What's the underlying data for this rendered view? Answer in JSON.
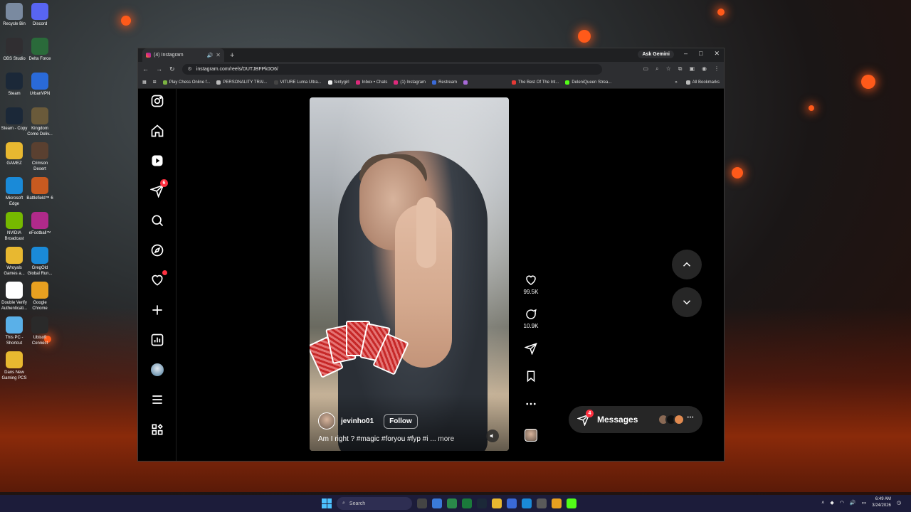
{
  "desktop": {
    "icons": [
      {
        "label": "Recycle Bin",
        "icon": "recycle-bin-icon",
        "color": "#7a8aa0"
      },
      {
        "label": "Discord",
        "icon": "discord-icon",
        "color": "#5865f2"
      },
      {
        "label": "OBS Studio",
        "icon": "obs-icon",
        "color": "#302e31"
      },
      {
        "label": "Delta Force",
        "icon": "delta-force-icon",
        "color": "#2a6a3a"
      },
      {
        "label": "Steam",
        "icon": "steam-icon",
        "color": "#1b2838"
      },
      {
        "label": "UrbanVPN",
        "icon": "urbanvpn-icon",
        "color": "#2a6ad8"
      },
      {
        "label": "Steam - Copy",
        "icon": "steam-icon",
        "color": "#1b2838"
      },
      {
        "label": "Kingdom Come Deliv...",
        "icon": "kingdom-come-icon",
        "color": "#6a5a3a"
      },
      {
        "label": "GAMEZ",
        "icon": "folder-icon",
        "color": "#e8b830"
      },
      {
        "label": "Crimson Desert",
        "icon": "crimson-desert-icon",
        "color": "#5a4030"
      },
      {
        "label": "Microsoft Edge",
        "icon": "edge-icon",
        "color": "#1a8ad8"
      },
      {
        "label": "Battlefield™ 6",
        "icon": "battlefield-icon",
        "color": "#c85a20"
      },
      {
        "label": "NVIDIA Broadcast",
        "icon": "nvidia-icon",
        "color": "#76b900"
      },
      {
        "label": "eFootball™",
        "icon": "efootball-icon",
        "color": "#b02a8a"
      },
      {
        "label": "Wroyals Games a...",
        "icon": "folder-icon",
        "color": "#e8b830"
      },
      {
        "label": "GregOld Global Run...",
        "icon": "edge-icon",
        "color": "#1a8ad8"
      },
      {
        "label": "Double Verify Authenticati...",
        "icon": "document-icon",
        "color": "#ffffff"
      },
      {
        "label": "Google Chrome",
        "icon": "chrome-icon",
        "color": "#e8a020"
      },
      {
        "label": "This PC - Shortcut",
        "icon": "this-pc-icon",
        "color": "#5ab0e8"
      },
      {
        "label": "Ubisoft Connect",
        "icon": "ubisoft-icon",
        "color": "#2a2a2a"
      },
      {
        "label": "Dans New Gaming PCS",
        "icon": "folder-icon",
        "color": "#e8b830"
      }
    ]
  },
  "browser": {
    "tab": {
      "title": "(4) Instagram"
    },
    "new_tab": "+",
    "ask_gemini": "Ask Gemini",
    "window_controls": {
      "minimize": "–",
      "maximize": "□",
      "close": "✕"
    },
    "url": "instagram.com/reels/DUTJBFPk0O6/",
    "bookmarks": [
      "Play Chess Online f...",
      "PERSONALITY TRAI...",
      "VITURE Luma Ultra...",
      "fentygirl",
      "Inbox • Chats",
      "(1) Instagram",
      "Restream",
      "",
      "The Best Of The Int...",
      "DeleniQueen Strea..."
    ],
    "all_bookmarks": "All Bookmarks"
  },
  "instagram": {
    "sidebar": {
      "notifications_badge": "6"
    },
    "reel": {
      "username": "jevinho01",
      "follow_label": "Follow",
      "caption": "Am I right ? #magic #foryou #fyp #i",
      "caption_more": "... more"
    },
    "actions": {
      "likes": "99.5K",
      "comments": "10.9K"
    },
    "messages": {
      "label": "Messages",
      "badge": "4"
    }
  },
  "taskbar": {
    "search_placeholder": "Search",
    "time": "6:49 AM",
    "date": "3/24/2026"
  },
  "colors": {
    "ig_badge": "#ff3040",
    "ig_bg": "#000000",
    "chrome_bar": "#2d2e31"
  }
}
